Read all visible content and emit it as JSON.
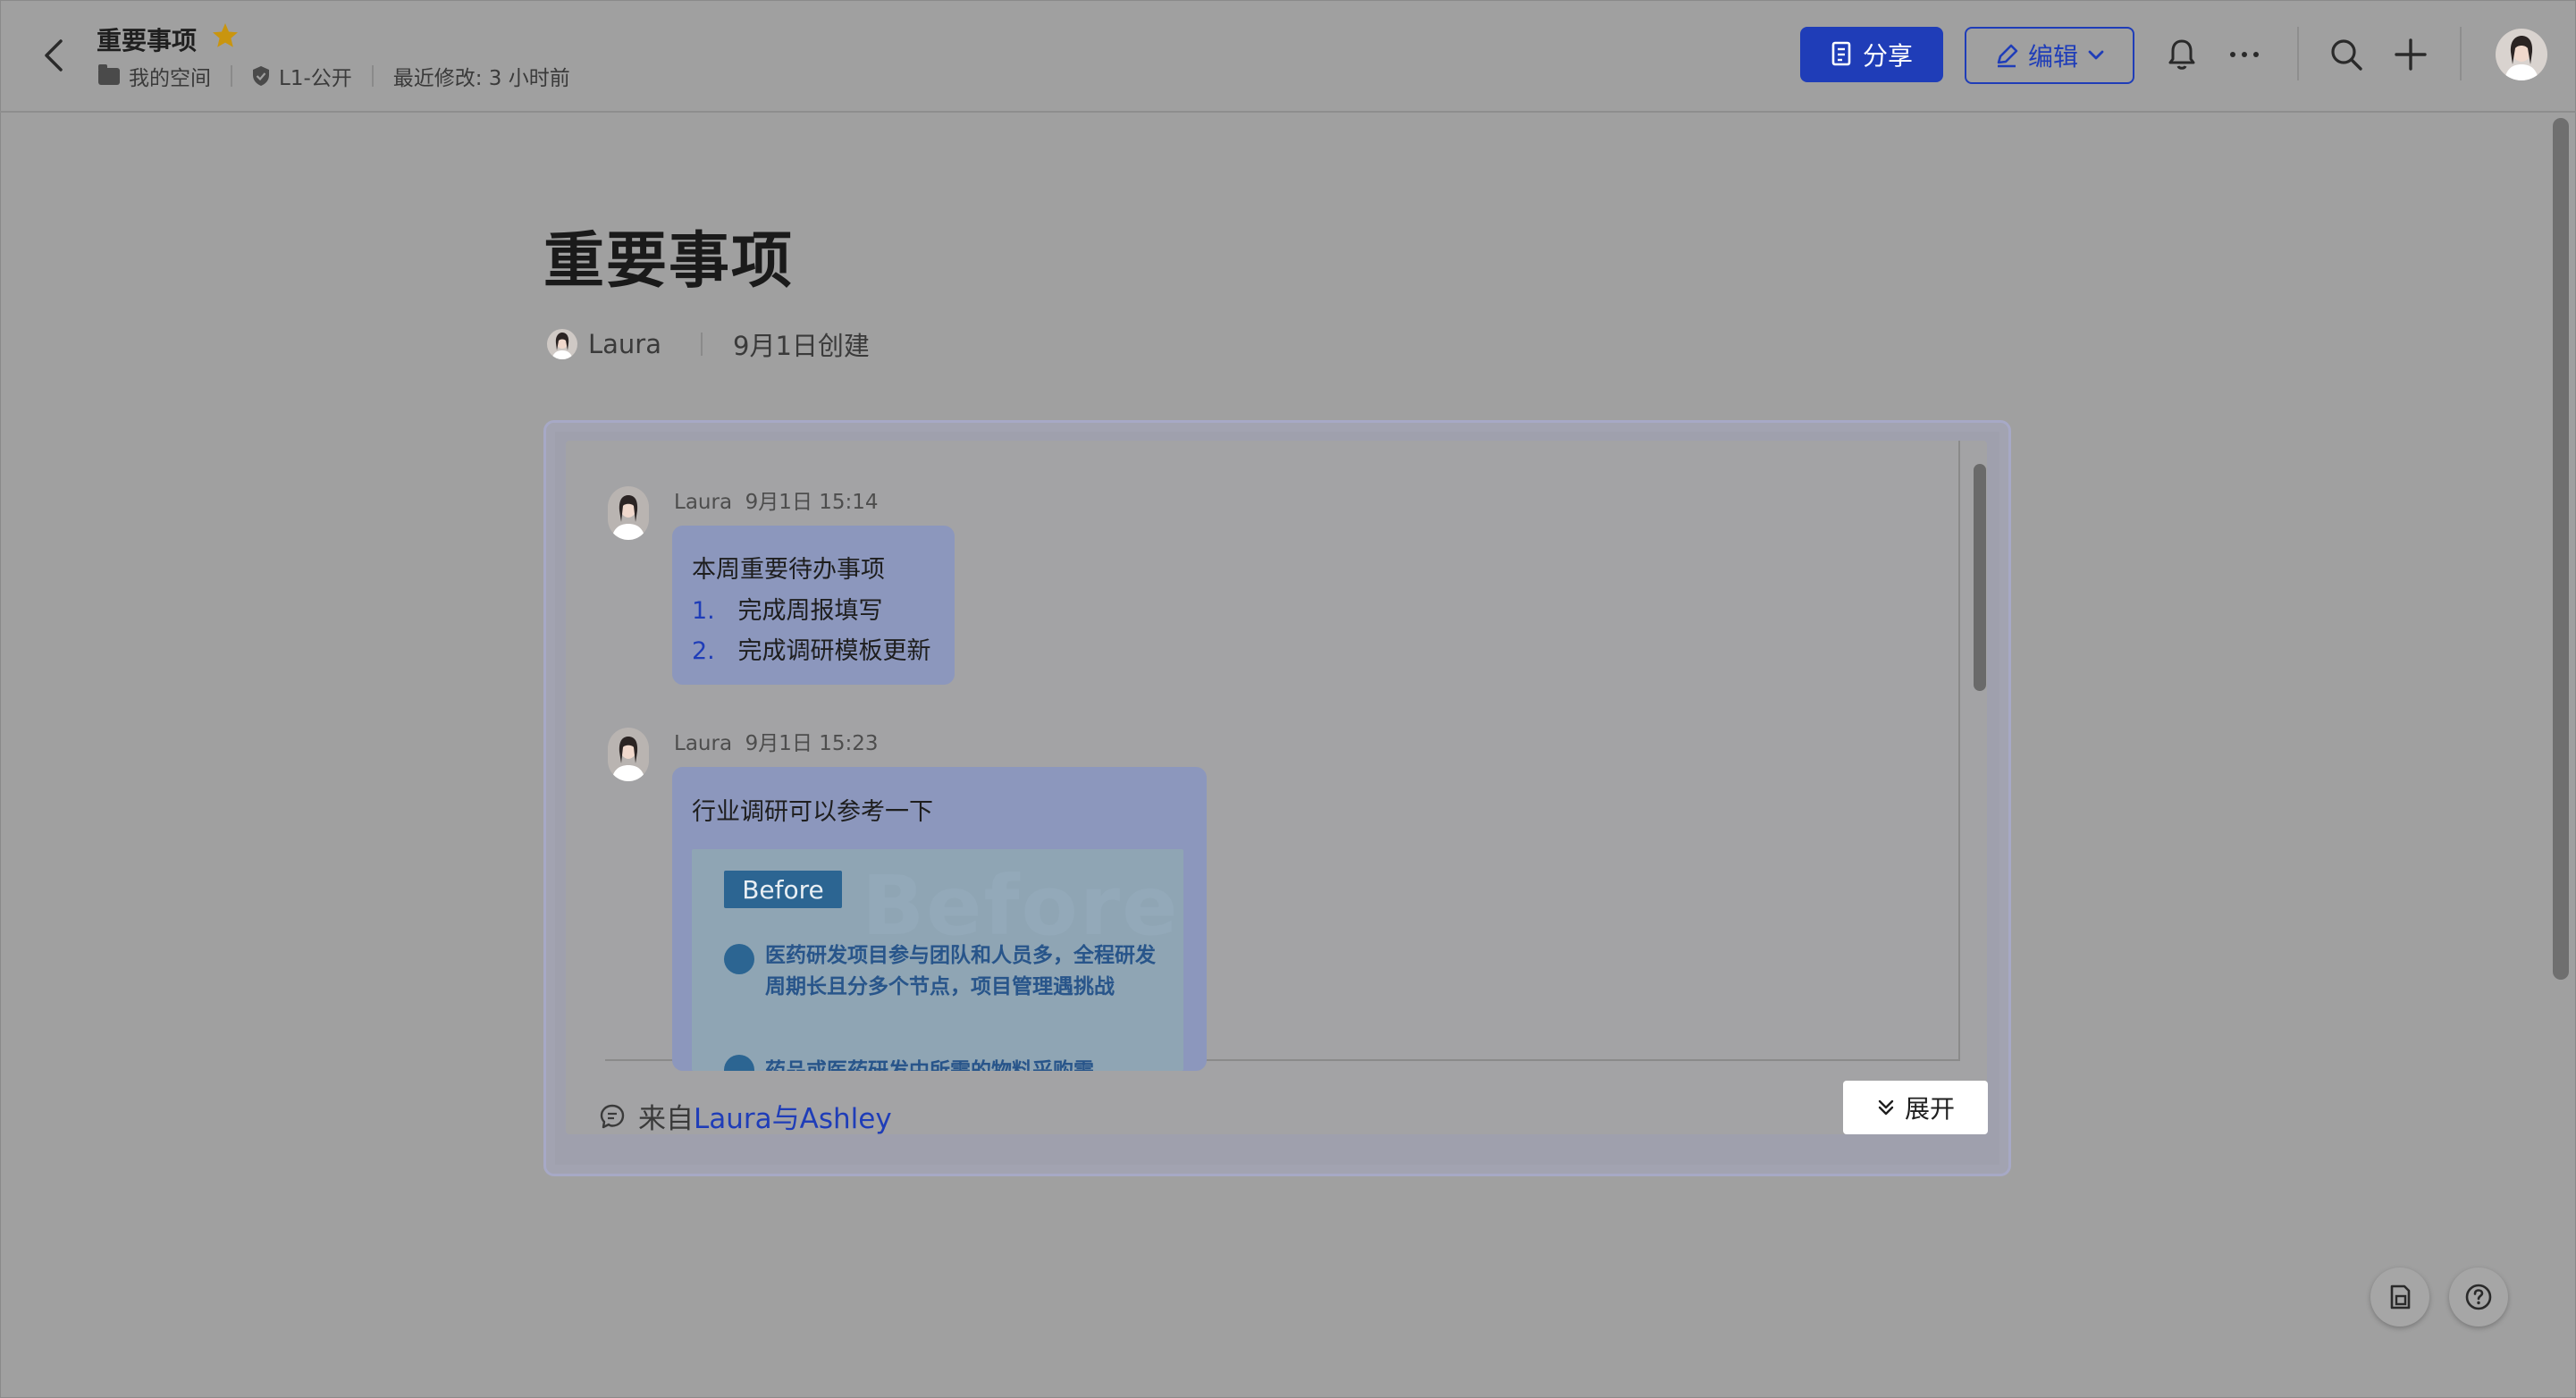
{
  "header": {
    "doc_title": "重要事项",
    "location": "我的空间",
    "permission": "L1-公开",
    "last_modified": "最近修改: 3 小时前",
    "share_label": "分享",
    "edit_label": "编辑"
  },
  "document": {
    "title": "重要事项",
    "author": "Laura",
    "created": "9月1日创建"
  },
  "chat_card": {
    "messages": [
      {
        "sender": "Laura",
        "time": "9月1日 15:14",
        "text": "本周重要待办事项",
        "list": [
          {
            "num": "1.",
            "text": "完成周报填写"
          },
          {
            "num": "2.",
            "text": "完成调研模板更新"
          }
        ]
      },
      {
        "sender": "Laura",
        "time": "9月1日 15:23",
        "text": "行业调研可以参考一下",
        "attachment": {
          "ghost_text": "Before",
          "tag": "Before",
          "bullet_1": "医药研发项目参与团队和人员多，全程研发周期长且分多个节点，项目管理遇挑战",
          "bullet_2": "药品或医药研发中所需的物料采购需"
        }
      }
    ],
    "source_prefix": "来自",
    "source_link": "Laura与Ashley",
    "expand_label": "展开"
  },
  "colors": {
    "accent": "#1f3db8",
    "star": "#c9950f",
    "overlay_bg": "#a0a0a0"
  },
  "icons": [
    "back-icon",
    "star-icon",
    "folder-icon",
    "shield-icon",
    "document-icon",
    "pen-icon",
    "chevron-down-icon",
    "bell-icon",
    "more-icon",
    "search-icon",
    "plus-icon",
    "comment-icon",
    "expand-icon",
    "doc-check-icon",
    "help-icon"
  ]
}
